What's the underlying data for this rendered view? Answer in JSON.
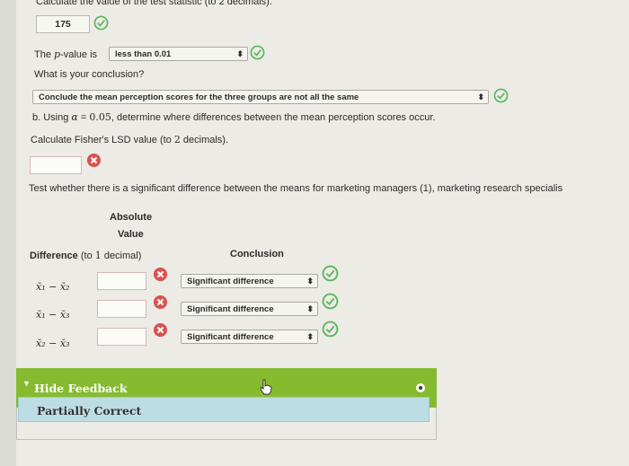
{
  "top": {
    "instruction": "Calculate the value of the test statistic (to 2 decimals).",
    "test_statistic": "175"
  },
  "pvalue": {
    "label_prefix": "The ",
    "label_p": "p",
    "label_suffix": "-value is",
    "selected": "less than 0.01"
  },
  "conclusion": {
    "question": "What is your conclusion?",
    "selected": "Conclude the mean perception scores for the three groups are not all the same"
  },
  "part_b": {
    "prefix": "b. Using ",
    "alpha": "α",
    "eq": " = ",
    "alpha_value": "0.05",
    "suffix": ", determine where differences between the mean perception scores occur.",
    "lsd_prompt_a": "Calculate Fisher's LSD value (to ",
    "lsd_prompt_num": "2",
    "lsd_prompt_b": " decimals).",
    "lsd_value": ""
  },
  "test_text": "Test whether there is a significant difference between the means for marketing managers (1), marketing research specialis",
  "table": {
    "header_abs_1": "Absolute",
    "header_abs_2": "Value",
    "header_diff": "Difference",
    "header_diff_note_a": "(to ",
    "header_diff_note_num": "1",
    "header_diff_note_b": " decimal)",
    "header_conclusion": "Conclusion",
    "rows": [
      {
        "diff": "x̄₁ − x̄₂",
        "value": "",
        "conclusion": "Significant difference"
      },
      {
        "diff": "x̄₁ − x̄₃",
        "value": "",
        "conclusion": "Significant difference"
      },
      {
        "diff": "x̄₂ − x̄₃",
        "value": "",
        "conclusion": "Significant difference"
      }
    ]
  },
  "feedback": {
    "toggle_label": "Hide Feedback",
    "status": "Partially Correct"
  },
  "colors": {
    "correct": "#5cb85c",
    "incorrect": "#d9534f",
    "feedback_bar": "#86bb30",
    "feedback_status_bg": "#bddde4"
  }
}
